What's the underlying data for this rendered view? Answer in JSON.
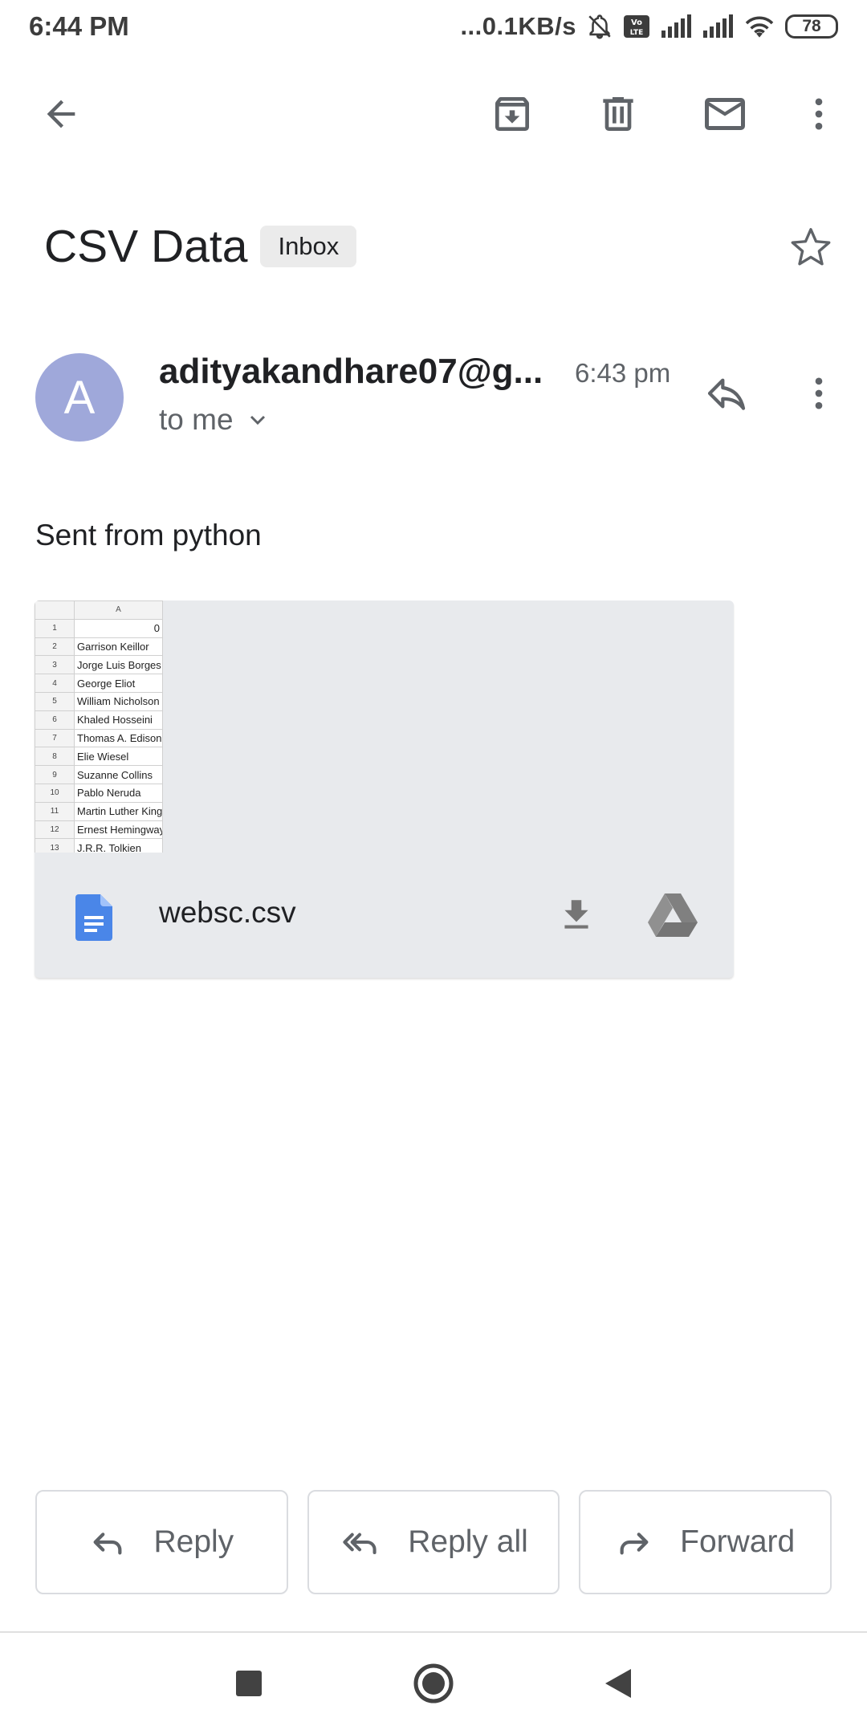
{
  "status_bar": {
    "time": "6:44 PM",
    "network_speed": "...0.1KB/s",
    "battery": "78",
    "icons": [
      "mute-icon",
      "volte-icon",
      "signal-icon",
      "signal-icon",
      "wifi-icon",
      "battery-icon"
    ]
  },
  "toolbar": {
    "icons": [
      "back-arrow-icon",
      "archive-icon",
      "trash-icon",
      "mail-icon",
      "more-vert-icon"
    ]
  },
  "email": {
    "subject": "CSV Data",
    "label": "Inbox",
    "sender_initial": "A",
    "sender": "adityakandhare07@g...",
    "recipient": "to me",
    "time": "6:43 pm",
    "body": "Sent from python",
    "avatar_color": "#9fa8da"
  },
  "attachment": {
    "file_name": "websc.csv",
    "preview": {
      "column_header": "A",
      "rows": [
        {
          "num": "1",
          "value": "0"
        },
        {
          "num": "2",
          "value": "Garrison Keillor"
        },
        {
          "num": "3",
          "value": "Jorge Luis Borges"
        },
        {
          "num": "4",
          "value": "George Eliot"
        },
        {
          "num": "5",
          "value": "William Nicholson"
        },
        {
          "num": "6",
          "value": "Khaled Hosseini"
        },
        {
          "num": "7",
          "value": "Thomas A. Edison"
        },
        {
          "num": "8",
          "value": "Elie Wiesel"
        },
        {
          "num": "9",
          "value": "Suzanne Collins"
        },
        {
          "num": "10",
          "value": "Pablo Neruda"
        },
        {
          "num": "11",
          "value": "Martin Luther King"
        },
        {
          "num": "12",
          "value": "Ernest Hemingway"
        },
        {
          "num": "13",
          "value": "J.R.R. Tolkien"
        }
      ]
    }
  },
  "actions": {
    "reply": "Reply",
    "reply_all": "Reply all",
    "forward": "Forward"
  },
  "colors": {
    "icon_gray": "#5f6368",
    "doc_blue": "#4a86e8",
    "attachment_bg": "#e8eaed"
  }
}
